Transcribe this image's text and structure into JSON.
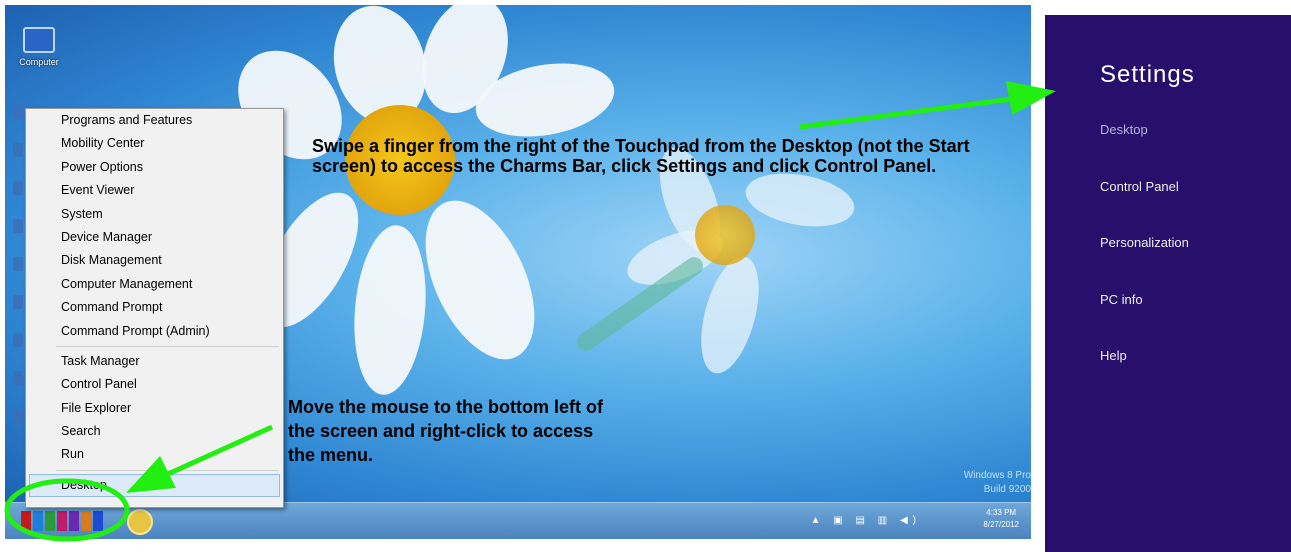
{
  "desktop": {
    "icon_label": "Computer",
    "watermark": [
      "Windows 8 Pro",
      "Build 9200"
    ]
  },
  "context_menu": {
    "groups": [
      [
        "Programs and Features",
        "Mobility Center",
        "Power Options",
        "Event Viewer",
        "System",
        "Device Manager",
        "Disk Management",
        "Computer Management",
        "Command Prompt",
        "Command Prompt (Admin)"
      ],
      [
        "Task Manager",
        "Control Panel",
        "File Explorer",
        "Search",
        "Run"
      ],
      [
        "Desktop"
      ]
    ],
    "selected": "Desktop"
  },
  "taskbar": {
    "clock_time": "4:33 PM",
    "clock_date": "8/27/2012"
  },
  "annotations": {
    "top": "Swipe a finger from the right of the Touchpad from the Desktop (not the Start screen) to access the Charms Bar, click Settings and click Control Panel.",
    "bottom": "Move the mouse to the bottom left of the screen and right-click to access the menu."
  },
  "charms": {
    "title": "Settings",
    "items": [
      "Desktop",
      "Control Panel",
      "Personalization",
      "PC info",
      "Help"
    ]
  },
  "colors": {
    "charms_bg": "#270f6b",
    "arrow": "#22ee11",
    "highlight_circle": "#22ee11"
  }
}
